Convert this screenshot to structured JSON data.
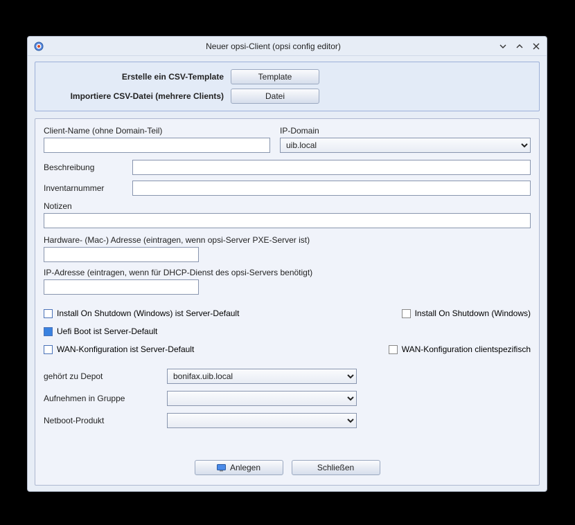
{
  "window": {
    "title": "Neuer opsi-Client (opsi config editor)"
  },
  "csv": {
    "template_label": "Erstelle ein CSV-Template",
    "template_button": "Template",
    "import_label": "Importiere CSV-Datei (mehrere Clients)",
    "import_button": "Datei"
  },
  "form": {
    "client_name_label": "Client-Name (ohne Domain-Teil)",
    "client_name_value": "",
    "ip_domain_label": "IP-Domain",
    "ip_domain_value": "uib.local",
    "description_label": "Beschreibung",
    "description_value": "",
    "inventory_label": "Inventarnummer",
    "inventory_value": "",
    "notes_label": "Notizen",
    "notes_value": "",
    "hwaddr_label": "Hardware- (Mac-) Adresse   (eintragen, wenn opsi-Server PXE-Server ist)",
    "hwaddr_value": "",
    "ipaddr_label": "IP-Adresse   (eintragen, wenn für DHCP-Dienst des opsi-Servers benötigt)",
    "ipaddr_value": ""
  },
  "checks": {
    "install_shutdown_default": "Install On Shutdown (Windows) ist Server-Default",
    "install_shutdown": "Install On Shutdown (Windows)",
    "uefi_default": "Uefi Boot ist Server-Default",
    "wan_default": "WAN-Konfiguration ist Server-Default",
    "wan_client": "WAN-Konfiguration clientspezifisch"
  },
  "dropdowns": {
    "depot_label": "gehört zu Depot",
    "depot_value": "bonifax.uib.local",
    "group_label": "Aufnehmen in Gruppe",
    "group_value": "",
    "netboot_label": "Netboot-Produkt",
    "netboot_value": ""
  },
  "footer": {
    "create": "Anlegen",
    "close": "Schließen"
  }
}
